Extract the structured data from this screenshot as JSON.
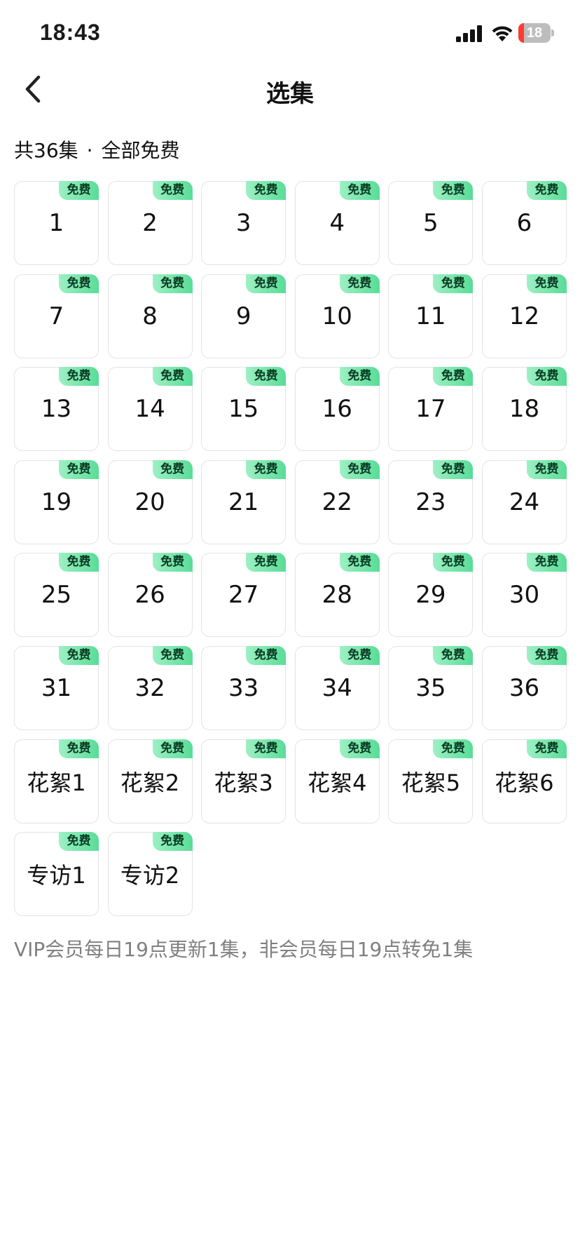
{
  "status_bar": {
    "time": "18:43",
    "battery": "18",
    "battery_level": 0.18
  },
  "nav": {
    "title": "选集"
  },
  "summary": {
    "count": "共36集",
    "separator": "·",
    "free_text": "全部免费"
  },
  "episodes": [
    {
      "label": "1",
      "badge": "免费"
    },
    {
      "label": "2",
      "badge": "免费"
    },
    {
      "label": "3",
      "badge": "免费"
    },
    {
      "label": "4",
      "badge": "免费"
    },
    {
      "label": "5",
      "badge": "免费"
    },
    {
      "label": "6",
      "badge": "免费"
    },
    {
      "label": "7",
      "badge": "免费"
    },
    {
      "label": "8",
      "badge": "免费"
    },
    {
      "label": "9",
      "badge": "免费"
    },
    {
      "label": "10",
      "badge": "免费"
    },
    {
      "label": "11",
      "badge": "免费"
    },
    {
      "label": "12",
      "badge": "免费"
    },
    {
      "label": "13",
      "badge": "免费"
    },
    {
      "label": "14",
      "badge": "免费"
    },
    {
      "label": "15",
      "badge": "免费"
    },
    {
      "label": "16",
      "badge": "免费"
    },
    {
      "label": "17",
      "badge": "免费"
    },
    {
      "label": "18",
      "badge": "免费"
    },
    {
      "label": "19",
      "badge": "免费"
    },
    {
      "label": "20",
      "badge": "免费"
    },
    {
      "label": "21",
      "badge": "免费"
    },
    {
      "label": "22",
      "badge": "免费"
    },
    {
      "label": "23",
      "badge": "免费"
    },
    {
      "label": "24",
      "badge": "免费"
    },
    {
      "label": "25",
      "badge": "免费"
    },
    {
      "label": "26",
      "badge": "免费"
    },
    {
      "label": "27",
      "badge": "免费"
    },
    {
      "label": "28",
      "badge": "免费"
    },
    {
      "label": "29",
      "badge": "免费"
    },
    {
      "label": "30",
      "badge": "免费"
    },
    {
      "label": "31",
      "badge": "免费"
    },
    {
      "label": "32",
      "badge": "免费"
    },
    {
      "label": "33",
      "badge": "免费"
    },
    {
      "label": "34",
      "badge": "免费"
    },
    {
      "label": "35",
      "badge": "免费"
    },
    {
      "label": "36",
      "badge": "免费"
    },
    {
      "label": "花絮1",
      "badge": "免费"
    },
    {
      "label": "花絮2",
      "badge": "免费"
    },
    {
      "label": "花絮3",
      "badge": "免费"
    },
    {
      "label": "花絮4",
      "badge": "免费"
    },
    {
      "label": "花絮5",
      "badge": "免费"
    },
    {
      "label": "花絮6",
      "badge": "免费"
    },
    {
      "label": "专访1",
      "badge": "免费"
    },
    {
      "label": "专访2",
      "badge": "免费"
    }
  ],
  "note": "VIP会员每日19点更新1集，非会员每日19点转免1集",
  "colors": {
    "badge_start": "#9ef0c4",
    "badge_end": "#59dc97",
    "battery_low": "#ff3b30",
    "note_text": "#808080"
  },
  "icons": {
    "back": "chevron-left-icon",
    "signal": "cellular-signal-icon",
    "wifi": "wifi-icon",
    "battery": "battery-icon"
  }
}
